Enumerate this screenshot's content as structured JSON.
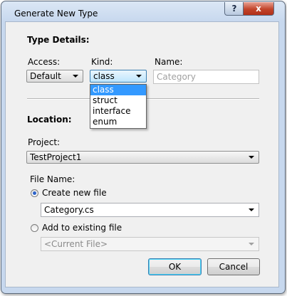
{
  "window": {
    "title": "Generate New Type",
    "help_glyph": "?",
    "close_glyph": "x"
  },
  "type_details": {
    "heading": "Type Details:",
    "access_label": "Access:",
    "access_value": "Default",
    "kind_label": "Kind:",
    "kind_value": "class",
    "kind_options": [
      "class",
      "struct",
      "interface",
      "enum"
    ],
    "name_label": "Name:",
    "name_value": "Category"
  },
  "location": {
    "heading": "Location:",
    "project_label": "Project:",
    "project_value": "TestProject1",
    "file_name_label": "File Name:",
    "create_new_label": "Create new file",
    "create_new_value": "Category.cs",
    "add_existing_label": "Add to existing file",
    "add_existing_value": "<Current File>"
  },
  "buttons": {
    "ok": "OK",
    "cancel": "Cancel"
  }
}
